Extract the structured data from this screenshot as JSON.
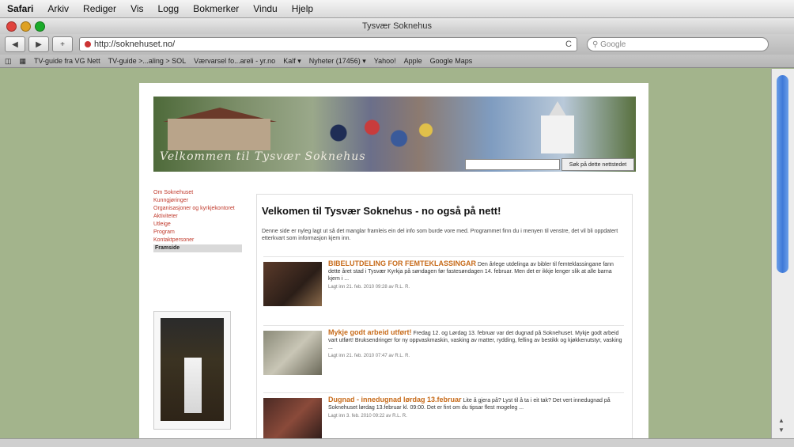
{
  "menubar": {
    "items": [
      "Safari",
      "Arkiv",
      "Rediger",
      "Vis",
      "Logg",
      "Bokmerker",
      "Vindu",
      "Hjelp"
    ]
  },
  "window": {
    "title": "Tysvær Soknehus",
    "url": "http://soknehuset.no/",
    "search_placeholder": "Google",
    "reload_label": "C"
  },
  "bookmarks": {
    "items": [
      "TV-guide fra VG Nett",
      "TV-guide >...aling > SOL",
      "Værvarsel fo...areli - yr.no",
      "Kalf ▾",
      "Nyheter (17456) ▾",
      "Yahoo!",
      "Apple",
      "Google Maps"
    ]
  },
  "page": {
    "banner": {
      "welcome_text": "Velkommen til Tysvær Soknehus",
      "search_button": "Søk på dette nettstedet"
    },
    "sidebar": {
      "links": [
        {
          "label": "Om Soknehuset",
          "active": false
        },
        {
          "label": "Kunngjøringer",
          "active": false
        },
        {
          "label": "Organisasjoner og kyrkjekontoret",
          "active": false
        },
        {
          "label": "Aktiviteter",
          "active": false
        },
        {
          "label": "Utleige",
          "active": false
        },
        {
          "label": "Program",
          "active": false
        },
        {
          "label": "Kontaktpersoner",
          "active": false
        },
        {
          "label": "Framside",
          "active": true
        }
      ]
    },
    "main": {
      "heading": "Velkomen til Tysvær Soknehus - no også på nett!",
      "intro": "Denne side er nyleg lagt ut så det manglar framleis ein del info som burde vore med. Programmet finn du i menyen til venstre, det vil bli oppdatert etterkvart som informasjon kjem inn.",
      "articles": [
        {
          "title": "BIBELUTDELING FOR FEMTEKLASSINGAR",
          "body": "Den årlege utdelinga av bibler til femteklassingane fann dette året stad i Tysvær Kyrkja på søndagen før fastesøndagen 14. februar. Men det er ikkje lenger slik at alle barna kjem i ...",
          "meta": "Lagt inn 21. feb. 2010 09:28 av R.L. R."
        },
        {
          "title": "Mykje godt arbeid utført!",
          "body": "Fredag 12. og Lørdag 13. februar var det dugnad på Soknehuset. Mykje godt arbeid vart utført! Bruksendringer for ny oppvaskmaskin, vasking av matter, rydding, felling av bestikk og kjøkkenutstyr, vasking ...",
          "meta": "Lagt inn 21. feb. 2010 07:47 av R.L. R."
        },
        {
          "title": "Dugnad - innedugnad lørdag 13.februar",
          "body": "Lite å gjera på? Lyst til å ta i eit tak? Det vert innedugnad på Soknehuset lørdag 13.februar kl. 09:00. Det er fint om du tipsar flest mogeleg ...",
          "meta": "Lagt inn 3. feb. 2010 09:22 av R.L. R."
        }
      ]
    }
  },
  "colors": {
    "background": "#a3b48c",
    "link_red": "#c0392b",
    "article_title": "#c76b1a"
  }
}
